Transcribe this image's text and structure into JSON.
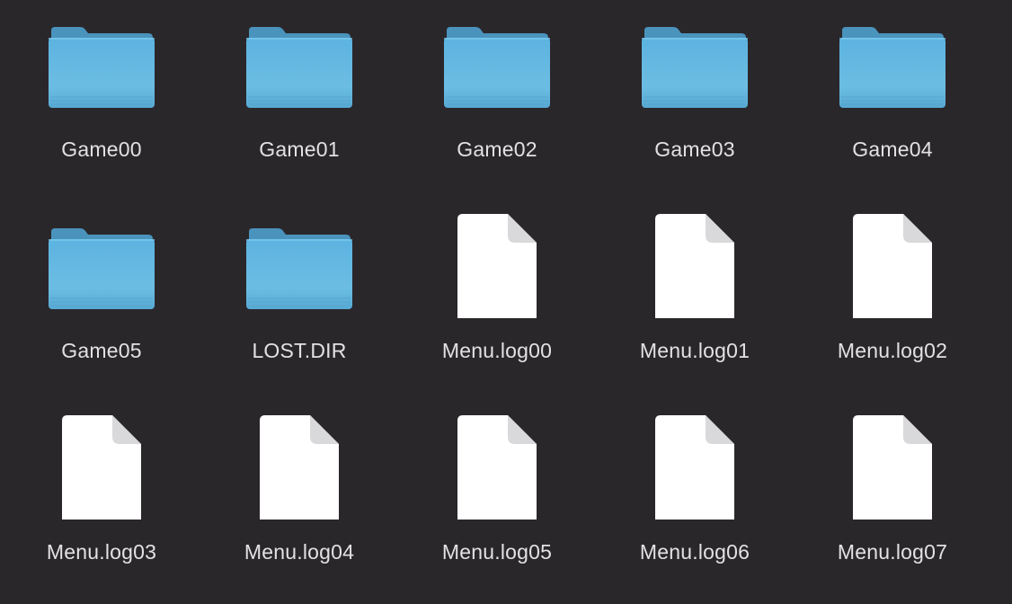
{
  "items": [
    {
      "name": "Game00",
      "kind": "folder"
    },
    {
      "name": "Game01",
      "kind": "folder"
    },
    {
      "name": "Game02",
      "kind": "folder"
    },
    {
      "name": "Game03",
      "kind": "folder"
    },
    {
      "name": "Game04",
      "kind": "folder"
    },
    {
      "name": "Game05",
      "kind": "folder"
    },
    {
      "name": "LOST.DIR",
      "kind": "folder"
    },
    {
      "name": "Menu.log00",
      "kind": "document"
    },
    {
      "name": "Menu.log01",
      "kind": "document"
    },
    {
      "name": "Menu.log02",
      "kind": "document"
    },
    {
      "name": "Menu.log03",
      "kind": "document"
    },
    {
      "name": "Menu.log04",
      "kind": "document"
    },
    {
      "name": "Menu.log05",
      "kind": "document"
    },
    {
      "name": "Menu.log06",
      "kind": "document"
    },
    {
      "name": "Menu.log07",
      "kind": "document"
    }
  ],
  "icons": {
    "folder": "folder-icon",
    "document": "document-icon"
  },
  "colors": {
    "background": "#2a272b",
    "folder_top": "#4f9fcc",
    "folder_body": "#5fb7e3",
    "document": "#ffffff",
    "label": "#e3e1e4"
  }
}
